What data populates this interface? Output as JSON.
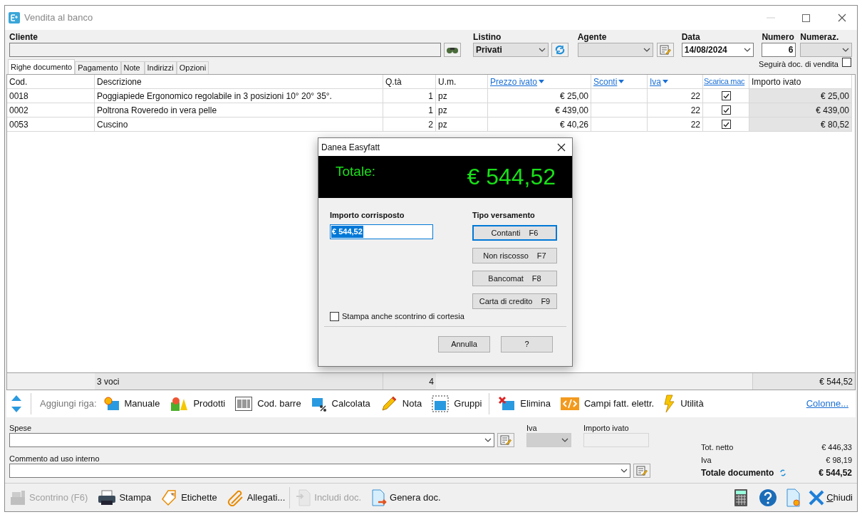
{
  "window": {
    "title": "Vendita al banco"
  },
  "header": {
    "cliente": {
      "label": "Cliente"
    },
    "listino": {
      "label": "Listino",
      "value": "Privati"
    },
    "agente": {
      "label": "Agente"
    },
    "data": {
      "label": "Data",
      "value": "14/08/2024"
    },
    "numero": {
      "label": "Numero",
      "value": "6"
    },
    "numeraz": {
      "label": "Numeraz."
    },
    "follow": {
      "label": "Seguirà doc. di vendita",
      "checked": false
    }
  },
  "tabs": [
    {
      "label": "Righe documento",
      "selected": true
    },
    {
      "label": "Pagamento",
      "selected": false
    },
    {
      "label": "Note",
      "selected": false
    },
    {
      "label": "Indirizzi",
      "selected": false
    },
    {
      "label": "Opzioni",
      "selected": false
    }
  ],
  "table": {
    "columns": [
      {
        "label": "Cod.",
        "kind": "plain"
      },
      {
        "label": "Descrizione",
        "kind": "plain"
      },
      {
        "label": "Q.tà",
        "kind": "plain"
      },
      {
        "label": "U.m.",
        "kind": "plain"
      },
      {
        "label": "Prezzo ivato",
        "kind": "sort"
      },
      {
        "label": "Sconti",
        "kind": "sort"
      },
      {
        "label": "Iva",
        "kind": "sort"
      },
      {
        "label": "Scarica mac",
        "kind": "link"
      },
      {
        "label": "Importo ivato",
        "kind": "plain"
      }
    ],
    "rows": [
      {
        "cod": "0018",
        "descrizione": "Poggiapiede Ergonomico regolabile in 3 posizioni 10° 20° 35°.",
        "qta": "1",
        "um": "pz",
        "prezzo": "€ 25,00",
        "iva": "22",
        "scarica": true,
        "importo": "€ 25,00"
      },
      {
        "cod": "0002",
        "descrizione": "Poltrona Roveredo in vera pelle",
        "qta": "1",
        "um": "pz",
        "prezzo": "€ 439,00",
        "iva": "22",
        "scarica": true,
        "importo": "€ 439,00"
      },
      {
        "cod": "0053",
        "descrizione": "Cuscino",
        "qta": "2",
        "um": "pz",
        "prezzo": "€ 40,26",
        "iva": "22",
        "scarica": true,
        "importo": "€ 80,52"
      }
    ],
    "footer": {
      "count": "3 voci",
      "qta": "4",
      "importo": "€ 544,52"
    }
  },
  "add_bar": {
    "label": "Aggiungi riga:",
    "items": [
      {
        "label": "Manuale",
        "kind": "manual"
      },
      {
        "label": "Prodotti",
        "kind": "products"
      },
      {
        "label": "Cod. barre",
        "kind": "barcode"
      },
      {
        "label": "Calcolata",
        "kind": "percent"
      },
      {
        "label": "Nota",
        "kind": "pencil"
      },
      {
        "label": "Gruppi",
        "kind": "group"
      },
      {
        "label": "Elimina",
        "kind": "delete"
      },
      {
        "label": "Campi fatt. elettr.",
        "kind": "code"
      },
      {
        "label": "Utilità",
        "kind": "bolt"
      }
    ],
    "link": "Colonne..."
  },
  "spese": {
    "label": "Spese"
  },
  "iva": {
    "label": "Iva"
  },
  "importo_ivato": {
    "label": "Importo ivato"
  },
  "commento": {
    "label": "Commento ad uso interno"
  },
  "totals": [
    {
      "label": "Tot. netto",
      "value": "€ 446,33",
      "bold": false
    },
    {
      "label": "Iva",
      "value": "€ 98,19",
      "bold": false
    },
    {
      "label": "Totale documento",
      "value": "€ 544,52",
      "bold": true
    }
  ],
  "toolbar": [
    {
      "label": "Scontrino (F6)",
      "kind": "register",
      "disabled": true
    },
    {
      "label": "Stampa",
      "kind": "printer",
      "disabled": false
    },
    {
      "label": "Etichette",
      "kind": "tag",
      "disabled": false
    },
    {
      "label": "Allegati...",
      "kind": "clip",
      "disabled": false
    },
    {
      "label": "Includi doc.",
      "kind": "include",
      "disabled": true
    },
    {
      "label": "Genera doc.",
      "kind": "generate",
      "disabled": false
    }
  ],
  "close": {
    "label": "Chiudi"
  },
  "dialog": {
    "title": "Danea Easyfatt",
    "total_label": "Totale:",
    "total_value": "€ 544,52",
    "amount": {
      "label": "Importo corrisposto",
      "value": "€ 544,52"
    },
    "payment": {
      "label": "Tipo versamento",
      "buttons": [
        {
          "label": "Contanti",
          "key": "F6",
          "focused": true
        },
        {
          "label": "Non riscosso",
          "key": "F7",
          "focused": false
        },
        {
          "label": "Bancomat",
          "key": "F8",
          "focused": false
        },
        {
          "label": "Carta di credito",
          "key": "F9",
          "focused": false
        }
      ]
    },
    "courtesy": {
      "label": "Stampa anche scontrino di cortesia",
      "checked": false
    },
    "buttons": [
      "Annulla",
      "?"
    ]
  }
}
